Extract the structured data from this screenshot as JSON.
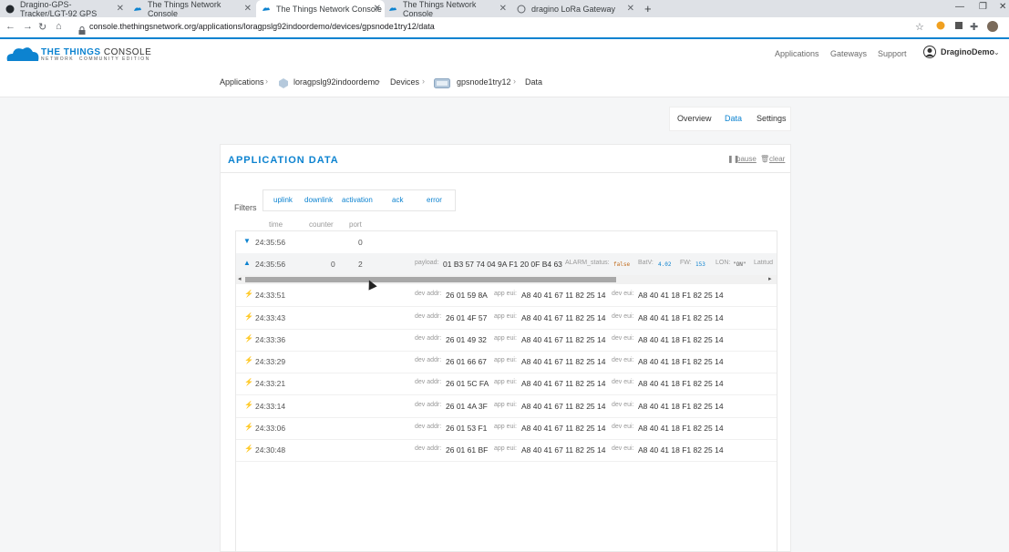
{
  "browser": {
    "tabs": [
      {
        "title": "Dragino-GPS-Tracker/LGT-92 GPS"
      },
      {
        "title": "The Things Network Console"
      },
      {
        "title": "The Things Network Console"
      },
      {
        "title": "The Things Network Console"
      },
      {
        "title": "dragino LoRa Gateway"
      }
    ],
    "url": "console.thethingsnetwork.org/applications/loragpslg92indoordemo/devices/gpsnode1try12/data"
  },
  "header": {
    "brand": "THE THINGS",
    "brand_sub": "NETWORK",
    "console": "CONSOLE",
    "edition": "COMMUNITY EDITION",
    "nav": [
      "Applications",
      "Gateways",
      "Support"
    ],
    "user": "DraginoDemo"
  },
  "breadcrumb": {
    "applications": "Applications",
    "app": "loragpslg92indoordemo",
    "devices": "Devices",
    "device": "gpsnode1try12",
    "page": "Data"
  },
  "subtabs": [
    "Overview",
    "Data",
    "Settings"
  ],
  "panel": {
    "title": "APPLICATION DATA",
    "pause": "pause",
    "clear": "clear",
    "filters_label": "Filters",
    "filters": [
      "uplink",
      "downlink",
      "activation",
      "ack",
      "error"
    ],
    "columns": [
      "time",
      "counter",
      "port"
    ]
  },
  "rows_top": [
    {
      "time": "24:35:56",
      "counter": "",
      "port": "0"
    },
    {
      "time": "24:35:56",
      "counter": "0",
      "port": "2",
      "payload_label": "payload:",
      "payload": "01 B3 57 74 04 9A F1 20 0F B4 63",
      "alarm_label": "ALARM_status:",
      "alarm": "false",
      "batv_label": "BatV:",
      "batv": "4.02",
      "fw_label": "FW:",
      "fw": "153",
      "lon_label": "LON:",
      "lon": "\"ON\"",
      "lat_label": "Latitud"
    }
  ],
  "labels": {
    "dev_addr": "dev addr:",
    "app_eui": "app eui:",
    "dev_eui": "dev eui:"
  },
  "activations": [
    {
      "time": "24:33:51",
      "dev_addr": "26 01 59 8A",
      "app_eui": "A8 40 41 67 11 82 25 14",
      "dev_eui": "A8 40 41 18 F1 82 25 14"
    },
    {
      "time": "24:33:43",
      "dev_addr": "26 01 4F 57",
      "app_eui": "A8 40 41 67 11 82 25 14",
      "dev_eui": "A8 40 41 18 F1 82 25 14"
    },
    {
      "time": "24:33:36",
      "dev_addr": "26 01 49 32",
      "app_eui": "A8 40 41 67 11 82 25 14",
      "dev_eui": "A8 40 41 18 F1 82 25 14"
    },
    {
      "time": "24:33:29",
      "dev_addr": "26 01 66 67",
      "app_eui": "A8 40 41 67 11 82 25 14",
      "dev_eui": "A8 40 41 18 F1 82 25 14"
    },
    {
      "time": "24:33:21",
      "dev_addr": "26 01 5C FA",
      "app_eui": "A8 40 41 67 11 82 25 14",
      "dev_eui": "A8 40 41 18 F1 82 25 14"
    },
    {
      "time": "24:33:14",
      "dev_addr": "26 01 4A 3F",
      "app_eui": "A8 40 41 67 11 82 25 14",
      "dev_eui": "A8 40 41 18 F1 82 25 14"
    },
    {
      "time": "24:33:06",
      "dev_addr": "26 01 53 F1",
      "app_eui": "A8 40 41 67 11 82 25 14",
      "dev_eui": "A8 40 41 18 F1 82 25 14"
    },
    {
      "time": "24:30:48",
      "dev_addr": "26 01 61 BF",
      "app_eui": "A8 40 41 67 11 82 25 14",
      "dev_eui": "A8 40 41 18 F1 82 25 14"
    }
  ],
  "colors": {
    "accent": "#0d83d0",
    "activation": "#f0a020"
  }
}
